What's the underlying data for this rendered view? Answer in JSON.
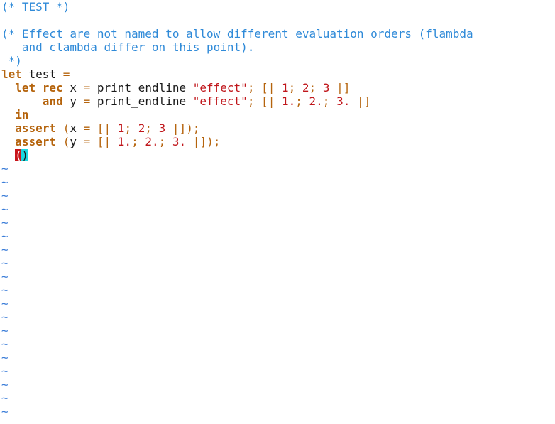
{
  "editor": {
    "lines": [
      {
        "segments": [
          {
            "type": "comment",
            "text": "(* TEST *)"
          }
        ]
      },
      {
        "segments": []
      },
      {
        "segments": [
          {
            "type": "comment",
            "text": "(* Effect are not named to allow different evaluation orders (flambda"
          }
        ]
      },
      {
        "segments": [
          {
            "type": "comment",
            "text": "   and clambda differ on this point)."
          }
        ]
      },
      {
        "segments": [
          {
            "type": "comment",
            "text": " *)"
          }
        ]
      },
      {
        "segments": [
          {
            "type": "kw",
            "text": "let"
          },
          {
            "type": "id",
            "text": " test "
          },
          {
            "type": "pun",
            "text": "="
          }
        ]
      },
      {
        "segments": [
          {
            "type": "id",
            "text": "  "
          },
          {
            "type": "kw",
            "text": "let rec"
          },
          {
            "type": "id",
            "text": " x "
          },
          {
            "type": "pun",
            "text": "="
          },
          {
            "type": "id",
            "text": " print_endline "
          },
          {
            "type": "str",
            "text": "\"effect\""
          },
          {
            "type": "pun",
            "text": "; [|"
          },
          {
            "type": "id",
            "text": " "
          },
          {
            "type": "num",
            "text": "1"
          },
          {
            "type": "pun",
            "text": ";"
          },
          {
            "type": "id",
            "text": " "
          },
          {
            "type": "num",
            "text": "2"
          },
          {
            "type": "pun",
            "text": ";"
          },
          {
            "type": "id",
            "text": " "
          },
          {
            "type": "num",
            "text": "3"
          },
          {
            "type": "id",
            "text": " "
          },
          {
            "type": "pun",
            "text": "|]"
          }
        ]
      },
      {
        "segments": [
          {
            "type": "id",
            "text": "      "
          },
          {
            "type": "kw",
            "text": "and"
          },
          {
            "type": "id",
            "text": " y "
          },
          {
            "type": "pun",
            "text": "="
          },
          {
            "type": "id",
            "text": " print_endline "
          },
          {
            "type": "str",
            "text": "\"effect\""
          },
          {
            "type": "pun",
            "text": "; [|"
          },
          {
            "type": "id",
            "text": " "
          },
          {
            "type": "num",
            "text": "1."
          },
          {
            "type": "pun",
            "text": ";"
          },
          {
            "type": "id",
            "text": " "
          },
          {
            "type": "num",
            "text": "2."
          },
          {
            "type": "pun",
            "text": ";"
          },
          {
            "type": "id",
            "text": " "
          },
          {
            "type": "num",
            "text": "3."
          },
          {
            "type": "id",
            "text": " "
          },
          {
            "type": "pun",
            "text": "|]"
          }
        ]
      },
      {
        "segments": [
          {
            "type": "id",
            "text": "  "
          },
          {
            "type": "kw",
            "text": "in"
          }
        ]
      },
      {
        "segments": [
          {
            "type": "id",
            "text": "  "
          },
          {
            "type": "kw",
            "text": "assert"
          },
          {
            "type": "id",
            "text": " "
          },
          {
            "type": "pun",
            "text": "("
          },
          {
            "type": "id",
            "text": "x "
          },
          {
            "type": "pun",
            "text": "="
          },
          {
            "type": "id",
            "text": " "
          },
          {
            "type": "pun",
            "text": "[|"
          },
          {
            "type": "id",
            "text": " "
          },
          {
            "type": "num",
            "text": "1"
          },
          {
            "type": "pun",
            "text": ";"
          },
          {
            "type": "id",
            "text": " "
          },
          {
            "type": "num",
            "text": "2"
          },
          {
            "type": "pun",
            "text": ";"
          },
          {
            "type": "id",
            "text": " "
          },
          {
            "type": "num",
            "text": "3"
          },
          {
            "type": "id",
            "text": " "
          },
          {
            "type": "pun",
            "text": "|]);"
          }
        ]
      },
      {
        "segments": [
          {
            "type": "id",
            "text": "  "
          },
          {
            "type": "kw",
            "text": "assert"
          },
          {
            "type": "id",
            "text": " "
          },
          {
            "type": "pun",
            "text": "("
          },
          {
            "type": "id",
            "text": "y "
          },
          {
            "type": "pun",
            "text": "="
          },
          {
            "type": "id",
            "text": " "
          },
          {
            "type": "pun",
            "text": "[|"
          },
          {
            "type": "id",
            "text": " "
          },
          {
            "type": "num",
            "text": "1."
          },
          {
            "type": "pun",
            "text": ";"
          },
          {
            "type": "id",
            "text": " "
          },
          {
            "type": "num",
            "text": "2."
          },
          {
            "type": "pun",
            "text": ";"
          },
          {
            "type": "id",
            "text": " "
          },
          {
            "type": "num",
            "text": "3."
          },
          {
            "type": "id",
            "text": " "
          },
          {
            "type": "pun",
            "text": "|]);"
          }
        ]
      },
      {
        "segments": [
          {
            "type": "id",
            "text": "  "
          },
          {
            "type": "cursor",
            "text": "("
          },
          {
            "type": "match",
            "text": ")"
          }
        ]
      }
    ],
    "tilde_char": "~",
    "tilde_count": 19,
    "colors": {
      "background": "#ffffff",
      "comment": "#2f8ad8",
      "keyword": "#b5640d",
      "string": "#c0161b",
      "cursor": "#c8141a",
      "match_paren": "#19d8e0",
      "tilde": "#3b7dd8"
    }
  }
}
